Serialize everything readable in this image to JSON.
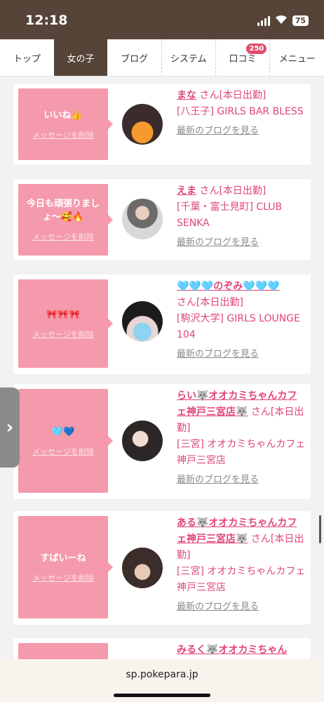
{
  "status": {
    "time": "12:18",
    "battery": "75"
  },
  "nav": {
    "tabs": [
      {
        "label": "トップ"
      },
      {
        "label": "女の子"
      },
      {
        "label": "ブログ"
      },
      {
        "label": "システム"
      },
      {
        "label": "口コミ",
        "badge": "250"
      },
      {
        "label": "メニュー"
      }
    ]
  },
  "messages": [
    {
      "message": "いいね👍",
      "delete_label": "メッセージを削除",
      "name": "まな",
      "suffix": "さん[本日出勤]",
      "shop": "[八王子] GIRLS BAR BLESS",
      "blog_label": "最新のブログを見る"
    },
    {
      "message": "今日も頑張りましょ〜🥰🔥",
      "delete_label": "メッセージを削除",
      "name": "えま",
      "suffix": "さん[本日出勤]",
      "shop": "[千葉・富士見町] CLUB SENKA",
      "blog_label": "最新のブログを見る"
    },
    {
      "message": "🎀🎀🎀",
      "delete_label": "メッセージを削除",
      "name": "🩵🩵🩵のぞみ🩵🩵🩵",
      "suffix": "さん[本日出勤]",
      "shop": "[駒沢大学] GIRLS LOUNGE 104",
      "blog_label": "最新のブログを見る"
    },
    {
      "message": "🩵💙",
      "delete_label": "メッセージを削除",
      "name": "らい🐺オオカミちゃんカフェ神戸三宮店🐺",
      "suffix": "さん[本日出勤]",
      "shop": "[三宮] オオカミちゃんカフェ神戸三宮店",
      "blog_label": "最新のブログを見る"
    },
    {
      "message": "すばいーね",
      "delete_label": "メッセージを削除",
      "name": "ある🐺オオカミちゃんカフェ神戸三宮店🐺",
      "suffix": "さん[本日出勤]",
      "shop": "[三宮] オオカミちゃんカフェ神戸三宮店",
      "blog_label": "最新のブログを見る"
    },
    {
      "name": "みるく🐺オオカミちゃん"
    }
  ],
  "browser": {
    "url": "sp.pokepara.jp"
  }
}
